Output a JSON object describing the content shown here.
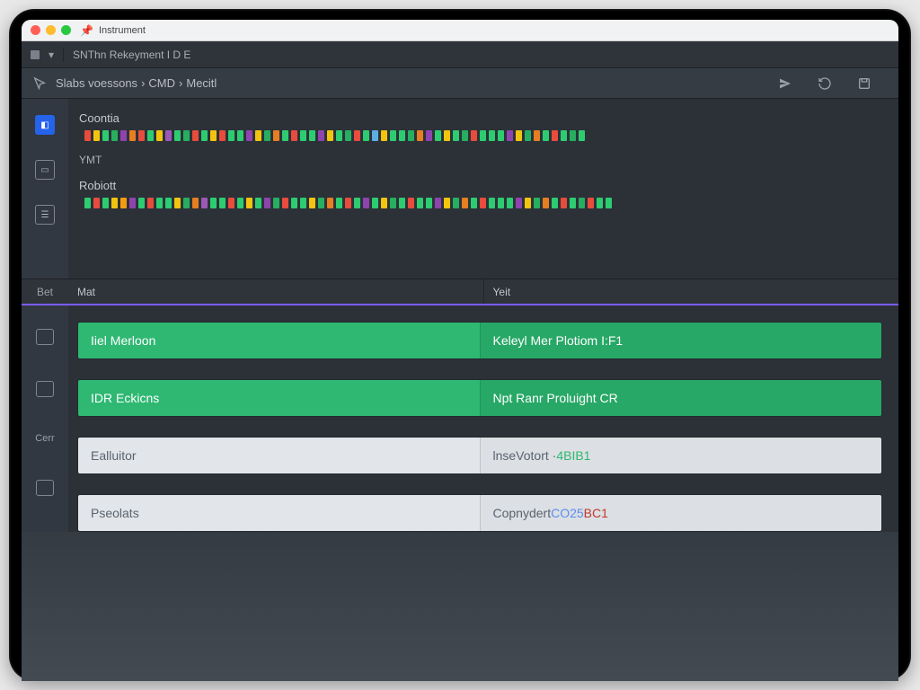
{
  "titlebar": {
    "project_label": "Instrument"
  },
  "tabbar": {
    "tab_label": "SNThn Rekeyment I D E"
  },
  "toolbar": {
    "breadcrumb": {
      "part1": "Slabs voessons",
      "sep": "›",
      "part2": "CMD",
      "sep2": "›",
      "part3": "Mecitl"
    }
  },
  "code": {
    "section1_label": "Coontia",
    "section2_label": "YMT",
    "section3_label": "Robiott",
    "row1_colors": [
      "#e74c3c",
      "#f1c40f",
      "#2ecc71",
      "#27ae60",
      "#8e44ad",
      "#e67e22",
      "#e74c3c",
      "#2ecc71",
      "#f1c40f",
      "#9b59b6",
      "#2ecc71",
      "#27ae60",
      "#e74c3c",
      "#2ecc71",
      "#f1c40f",
      "#e74c3c",
      "#2ecc71",
      "#2ecc71",
      "#8e44ad",
      "#f1c40f",
      "#27ae60",
      "#e67e22",
      "#2ecc71",
      "#e74c3c",
      "#2ecc71",
      "#2ecc71",
      "#8e44ad",
      "#f1c40f",
      "#2ecc71",
      "#27ae60",
      "#e74c3c",
      "#2ecc71",
      "#5dade2",
      "#f1c40f",
      "#2ecc71",
      "#2ecc71",
      "#27ae60",
      "#e67e22",
      "#8e44ad",
      "#2ecc71",
      "#f1c40f",
      "#2ecc71",
      "#27ae60",
      "#e74c3c",
      "#2ecc71",
      "#2ecc71",
      "#2ecc71",
      "#8e44ad",
      "#f1c40f",
      "#27ae60",
      "#e67e22",
      "#2ecc71",
      "#e74c3c",
      "#2ecc71",
      "#27ae60",
      "#2ecc71"
    ],
    "row2_colors": [
      "#2ecc71",
      "#e74c3c",
      "#2ecc71",
      "#f1c40f",
      "#f39c12",
      "#8e44ad",
      "#2ecc71",
      "#e74c3c",
      "#2ecc71",
      "#2ecc71",
      "#f1c40f",
      "#27ae60",
      "#e67e22",
      "#9b59b6",
      "#2ecc71",
      "#2ecc71",
      "#e74c3c",
      "#2ecc71",
      "#f1c40f",
      "#2ecc71",
      "#8e44ad",
      "#27ae60",
      "#e74c3c",
      "#2ecc71",
      "#2ecc71",
      "#f1c40f",
      "#27ae60",
      "#e67e22",
      "#2ecc71",
      "#e74c3c",
      "#2ecc71",
      "#8e44ad",
      "#2ecc71",
      "#f1c40f",
      "#27ae60",
      "#2ecc71",
      "#e74c3c",
      "#2ecc71",
      "#2ecc71",
      "#8e44ad",
      "#f1c40f",
      "#27ae60",
      "#e67e22",
      "#2ecc71",
      "#e74c3c",
      "#2ecc71",
      "#2ecc71",
      "#2ecc71",
      "#8e44ad",
      "#f1c40f",
      "#27ae60",
      "#e67e22",
      "#2ecc71",
      "#e74c3c",
      "#2ecc71",
      "#27ae60",
      "#e74c3c",
      "#2ecc71",
      "#2ecc71"
    ]
  },
  "panel": {
    "header": {
      "col1": "Bet",
      "col2": "Mat",
      "col3": "Yeit"
    },
    "rows": [
      {
        "style": "green",
        "left": "Iiel Merloon",
        "right": "Keleyl Mer Plotiom I:F1"
      },
      {
        "style": "green",
        "left": "IDR Eckicns",
        "right": "Npt Ranr Proluight CR"
      },
      {
        "style": "light",
        "left": "Ealluitor",
        "right_a": "lnseVotort ·",
        "right_b": " 4BIB1"
      },
      {
        "style": "light",
        "left": "Pseolats",
        "right_a": "Copnydert ",
        "right_b": "CO25 ",
        "right_c": "BC1"
      }
    ]
  }
}
